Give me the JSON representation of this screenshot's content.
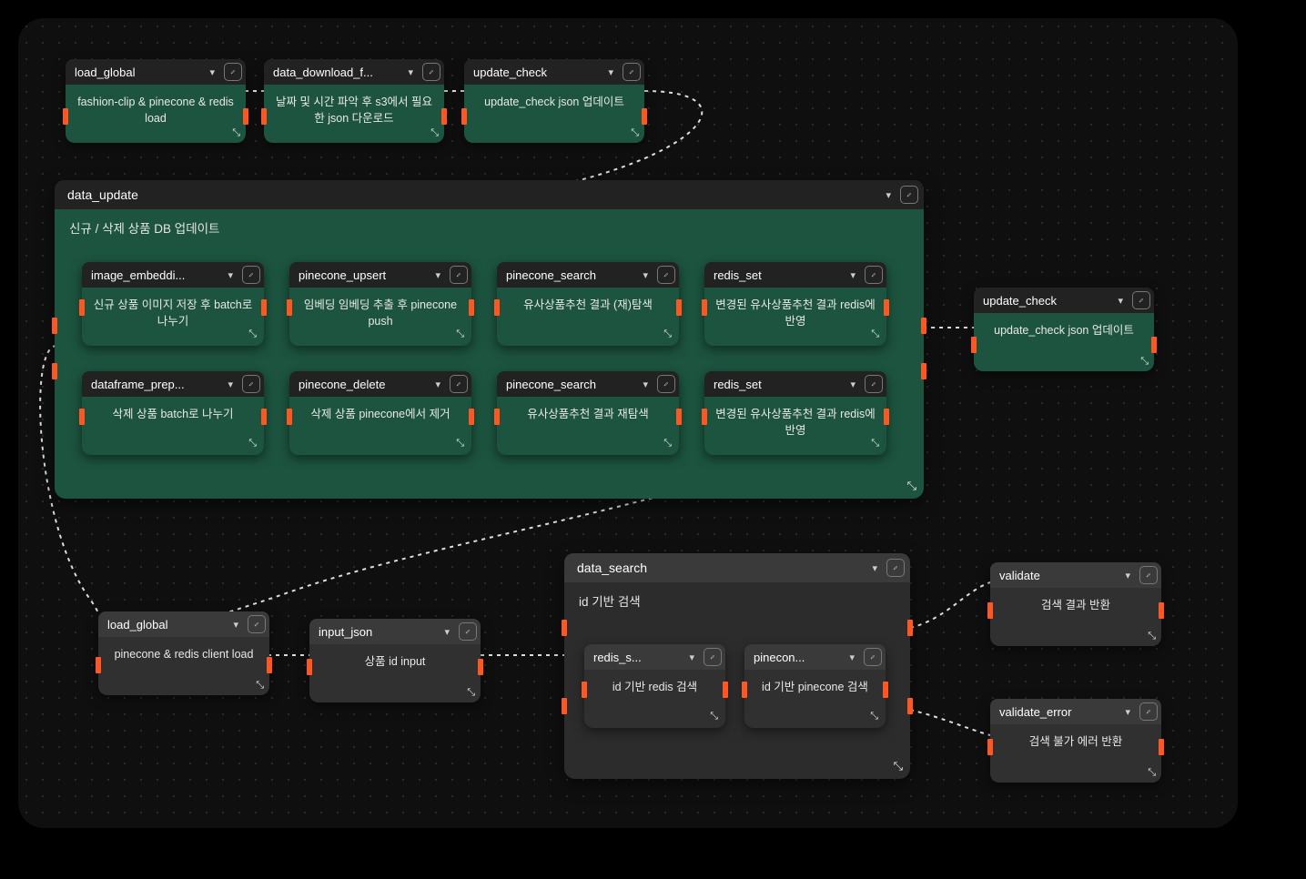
{
  "top": {
    "n1": {
      "title": "load_global",
      "body": "fashion-clip & pinecone & redis load"
    },
    "n2": {
      "title": "data_download_f...",
      "body": "날짜 및 시간 파악 후 s3에서 필요한 json 다운로드"
    },
    "n3": {
      "title": "update_check",
      "body": "update_check json 업데이트"
    }
  },
  "group1": {
    "title": "data_update",
    "subtitle": "신규 / 삭제 상품 DB 업데이트",
    "row1": {
      "a": {
        "title": "image_embeddi...",
        "body": "신규 상품 이미지 저장 후 batch로 나누기"
      },
      "b": {
        "title": "pinecone_upsert",
        "body": "임베딩 임베딩 추출 후 pinecone push"
      },
      "c": {
        "title": "pinecone_search",
        "body": "유사상품추천 결과 (재)탐색"
      },
      "d": {
        "title": "redis_set",
        "body": "변경된 유사상품추천 결과 redis에 반영"
      }
    },
    "row2": {
      "a": {
        "title": "dataframe_prep...",
        "body": "삭제 상품 batch로 나누기"
      },
      "b": {
        "title": "pinecone_delete",
        "body": "삭제 상품 pinecone에서 제거"
      },
      "c": {
        "title": "pinecone_search",
        "body": "유사상품추천 결과 재탐색"
      },
      "d": {
        "title": "redis_set",
        "body": "변경된 유사상품추천 결과 redis에 반영"
      }
    }
  },
  "right": {
    "uc": {
      "title": "update_check",
      "body": "update_check json 업데이트"
    }
  },
  "bottom": {
    "lg": {
      "title": "load_global",
      "body": "pinecone & redis client load"
    },
    "ij": {
      "title": "input_json",
      "body": "상품 id input"
    }
  },
  "group2": {
    "title": "data_search",
    "subtitle": "id 기반 검색",
    "a": {
      "title": "redis_s...",
      "body": "id 기반 redis 검색"
    },
    "b": {
      "title": "pinecon...",
      "body": "id 기반 pinecone 검색"
    }
  },
  "out": {
    "v": {
      "title": "validate",
      "body": "검색 결과 반환"
    },
    "ve": {
      "title": "validate_error",
      "body": "검색 불가 에러 반환"
    }
  }
}
